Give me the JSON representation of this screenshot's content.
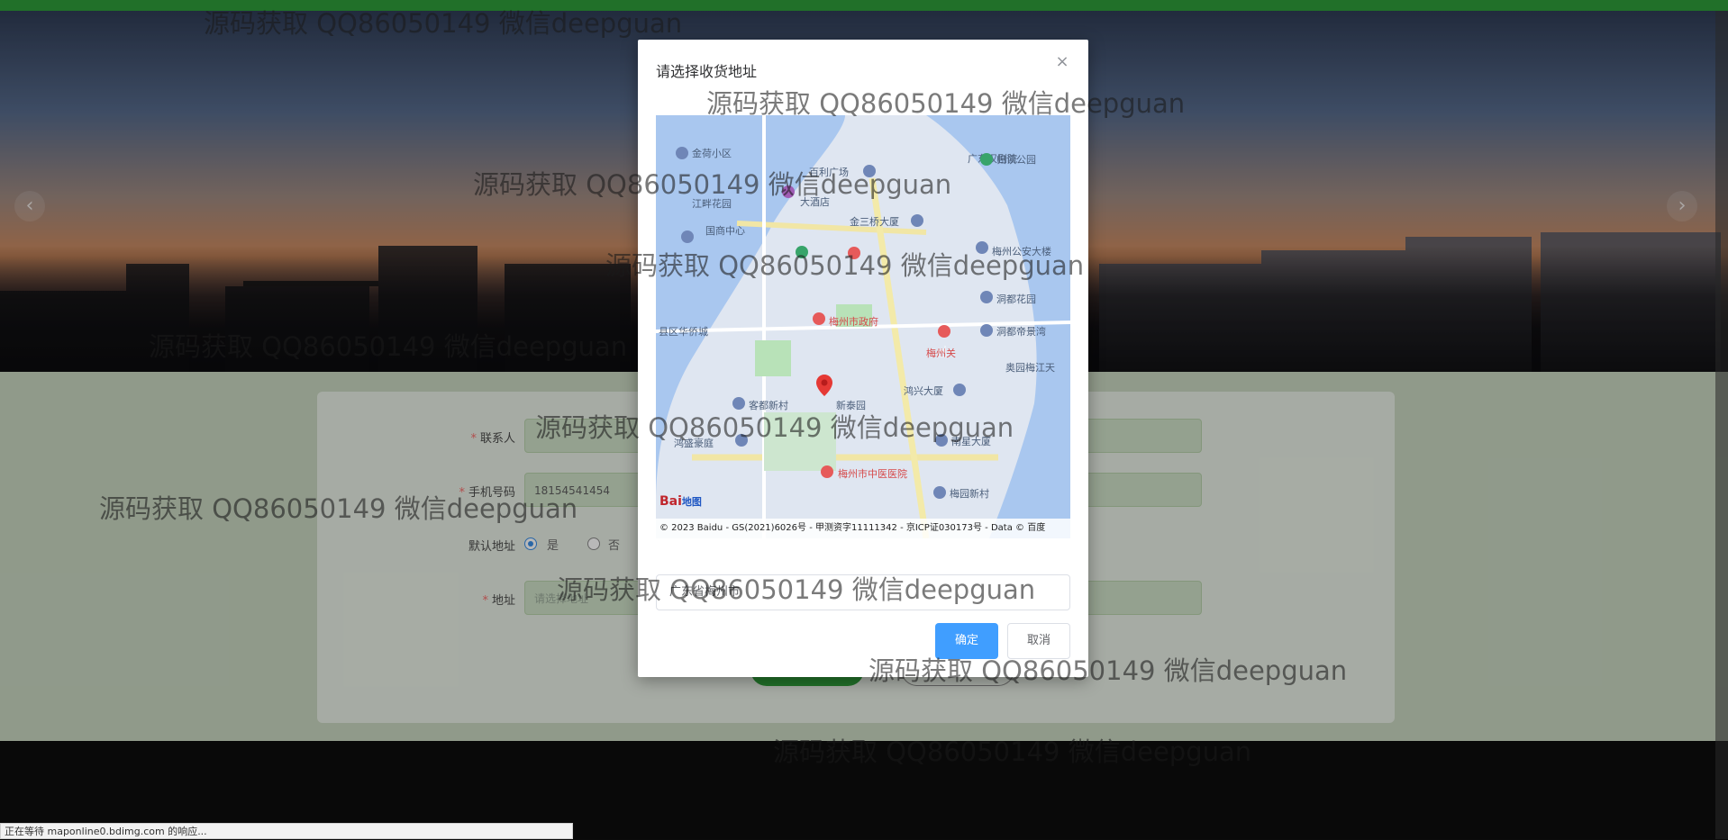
{
  "dialog": {
    "title": "请选择收货地址",
    "close_icon": "close-icon",
    "map": {
      "labels": [
        {
          "text": "金荷小区",
          "color": "#4b5e7a"
        },
        {
          "text": "百利广场",
          "color": "#4b5e7a"
        },
        {
          "text": "江畔花园",
          "color": "#4b5e7a"
        },
        {
          "text": "大酒店",
          "color": "#4b5e7a"
        },
        {
          "text": "金三桥大厦",
          "color": "#4b5e7a"
        },
        {
          "text": "国商中心",
          "color": "#4b5e7a"
        },
        {
          "text": "梅州市政府",
          "color": "#d64a4a"
        },
        {
          "text": "梅州公安大楼",
          "color": "#4b5e7a"
        },
        {
          "text": "洞都花园",
          "color": "#4b5e7a"
        },
        {
          "text": "洞都帝景湾",
          "color": "#4b5e7a"
        },
        {
          "text": "奥园梅江天",
          "color": "#4b5e7a"
        },
        {
          "text": "鸿兴大厦",
          "color": "#4b5e7a"
        },
        {
          "text": "客都新村",
          "color": "#4b5e7a"
        },
        {
          "text": "新泰园",
          "color": "#4b5e7a"
        },
        {
          "text": "鸿盛豪庭",
          "color": "#4b5e7a"
        },
        {
          "text": "南星大厦",
          "color": "#4b5e7a"
        },
        {
          "text": "梅州市中医医院",
          "color": "#d64a4a"
        },
        {
          "text": "梅园新村",
          "color": "#4b5e7a"
        },
        {
          "text": "广东汉剧院",
          "color": "#4b5e7a"
        },
        {
          "text": "归读公园",
          "color": "#4b5e7a"
        },
        {
          "text": "县区华侨城",
          "color": "#4b5e7a"
        },
        {
          "text": "梅州关",
          "color": "#d64a4a"
        }
      ],
      "footer": "© 2023 Baidu - GS(2021)6026号 - 甲测资字11111342 - 京ICP证030173号 - Data © 百度",
      "logo_text": "Bai",
      "logo_suffix": "地图",
      "locate_icon": "locate-icon"
    },
    "address_value": "广东省梅州市",
    "confirm_label": "确定",
    "cancel_label": "取消"
  },
  "form": {
    "contact_label": "联系人",
    "phone_label": "手机号码",
    "phone_value": "18154541454",
    "default_label": "默认地址",
    "default_yes": "是",
    "default_no": "否",
    "address_label": "地址",
    "address_placeholder": "请选择地址"
  },
  "status_bar": "正在等待 maponline0.bdimg.com 的响应...",
  "watermark": "源码获取 QQ86050149 微信deepguan"
}
